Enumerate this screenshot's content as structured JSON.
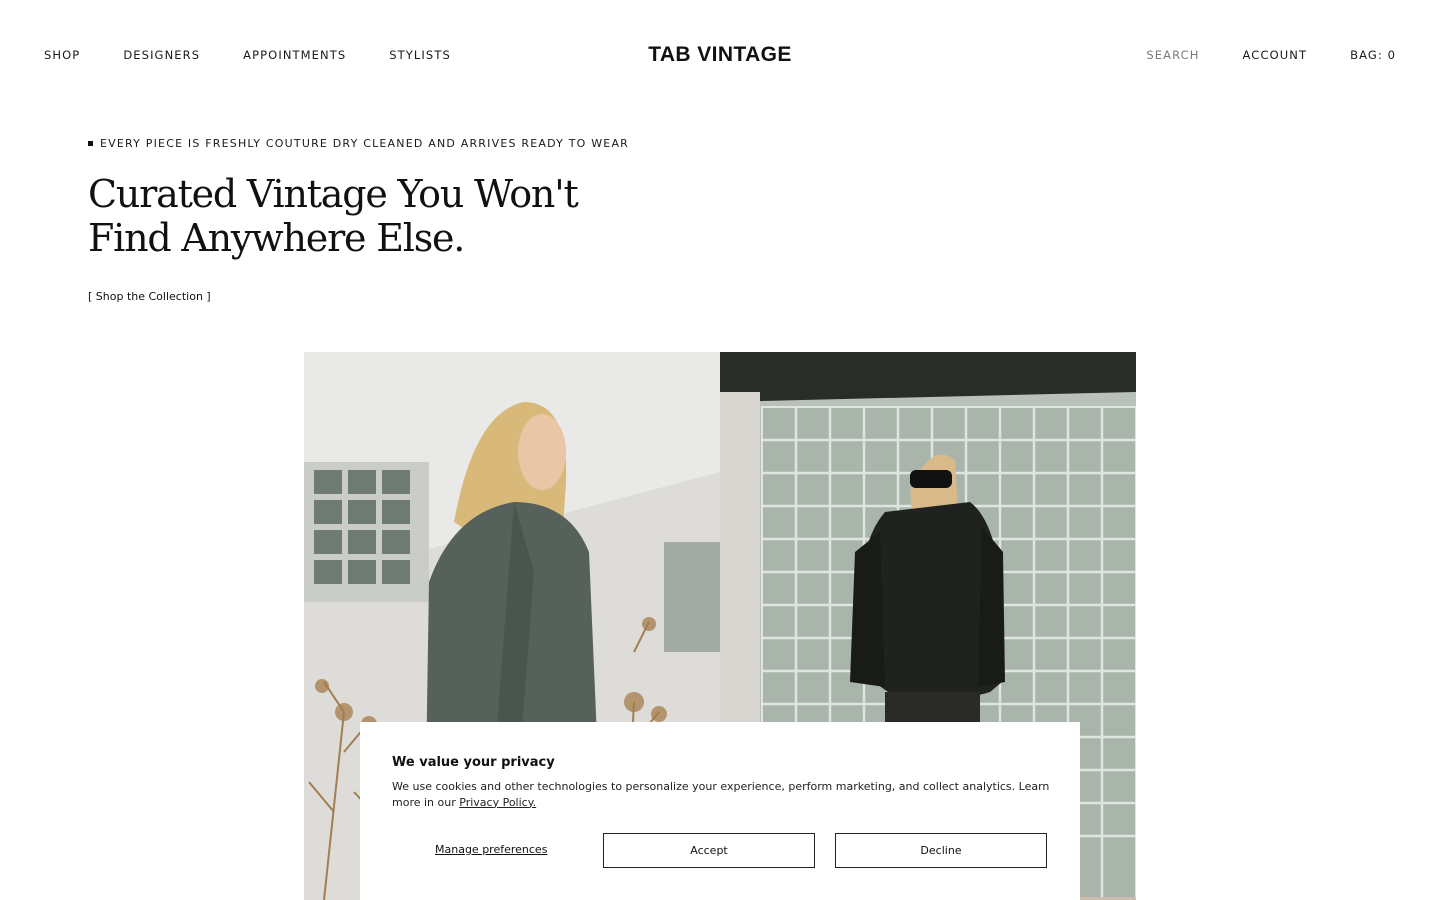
{
  "nav": {
    "left": [
      {
        "label": "SHOP"
      },
      {
        "label": "DESIGNERS"
      },
      {
        "label": "APPOINTMENTS"
      },
      {
        "label": "STYLISTS"
      }
    ],
    "logo": "TAB VINTAGE",
    "search_label": "SEARCH",
    "account_label": "ACCOUNT",
    "bag_label": "BAG: 0"
  },
  "hero_text": {
    "eyebrow": "EVERY PIECE IS FRESHLY COUTURE DRY CLEANED AND ARRIVES READY TO WEAR",
    "headline": "Curated Vintage You Won't Find Anywhere Else.",
    "cta": "[ Shop the Collection ]"
  },
  "cookie_banner": {
    "title": "We value your privacy",
    "text": "We use cookies and other technologies to personalize your experience, perform marketing, and collect analytics. Learn more in our",
    "policy_link": "Privacy Policy.",
    "manage_label": "Manage preferences",
    "accept_label": "Accept",
    "decline_label": "Decline"
  },
  "colors": {
    "text": "#111111",
    "muted": "#7a7a7a",
    "background": "#ffffff"
  }
}
